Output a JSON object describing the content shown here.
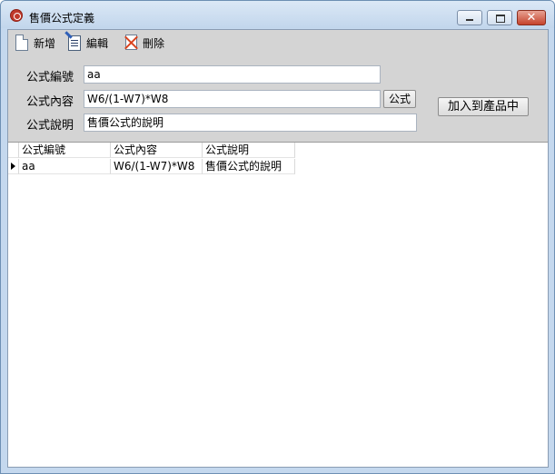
{
  "window": {
    "title": "售價公式定義",
    "close_glyph": "✕"
  },
  "toolbar": {
    "new_label": "新增",
    "edit_label": "編輯",
    "delete_label": "刪除"
  },
  "form": {
    "code_label": "公式編號",
    "code_value": "aa",
    "content_label": "公式內容",
    "content_value": "W6/(1-W7)*W8",
    "formula_button": "公式",
    "desc_label": "公式說明",
    "desc_value": "售價公式的說明",
    "add_to_product_button": "加入到產品中"
  },
  "grid": {
    "columns": [
      "公式編號",
      "公式內容",
      "公式說明"
    ],
    "rows": [
      [
        "aa",
        "W6/(1-W7)*W8",
        "售價公式的說明"
      ]
    ]
  },
  "colors": {
    "title_bar": "#c2d6ec",
    "panel_bg": "#d4d4d4",
    "close_button": "#c5432c"
  }
}
